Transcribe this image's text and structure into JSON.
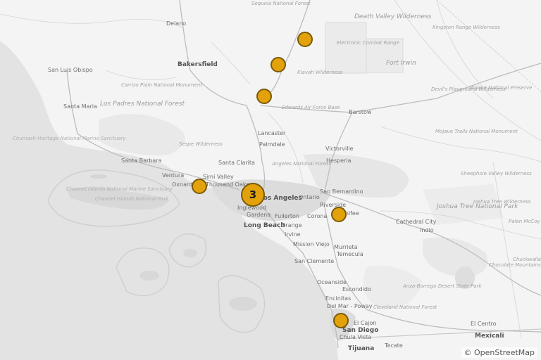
{
  "map": {
    "attribution": "© OpenStreetMap",
    "colors": {
      "land": "#f4f4f4",
      "ocean": "#e3e3e3",
      "marker_fill": "#e3a20c",
      "marker_stroke": "#7a5a08"
    },
    "places": [
      {
        "id": "sequoia-nf",
        "text": "Sequoia National Forest",
        "kind": "area"
      },
      {
        "id": "delano",
        "text": "Delano",
        "kind": "city"
      },
      {
        "id": "death-valley",
        "text": "Death Valley Wilderness",
        "kind": "area-large"
      },
      {
        "id": "kingston-range",
        "text": "Kingston Range Wilderness",
        "kind": "area"
      },
      {
        "id": "electronic-combat",
        "text": "Electronic Combat Range",
        "kind": "area"
      },
      {
        "id": "fort-irwin",
        "text": "Fort Irwin",
        "kind": "area-large"
      },
      {
        "id": "bakersfield",
        "text": "Bakersfield",
        "kind": "big"
      },
      {
        "id": "san-luis-obispo",
        "text": "San Luis Obispo",
        "kind": "city"
      },
      {
        "id": "carrizo-plain",
        "text": "Carrizo Plain National Monument",
        "kind": "area"
      },
      {
        "id": "kiavah",
        "text": "Kiavah Wilderness",
        "kind": "area"
      },
      {
        "id": "devils-playground",
        "text": "Devil's Playground Wilderness",
        "kind": "area"
      },
      {
        "id": "mojave-np",
        "text": "Mojave National Preserve",
        "kind": "area"
      },
      {
        "id": "santa-maria",
        "text": "Santa Maria",
        "kind": "city"
      },
      {
        "id": "los-padres",
        "text": "Los Padres National Forest",
        "kind": "area-large"
      },
      {
        "id": "edwards-afb",
        "text": "Edwards Air Force Base",
        "kind": "area"
      },
      {
        "id": "barstow",
        "text": "Barstow",
        "kind": "city"
      },
      {
        "id": "mojave-trails",
        "text": "Mojave Trails National Monument",
        "kind": "area"
      },
      {
        "id": "lancaster",
        "text": "Lancaster",
        "kind": "city"
      },
      {
        "id": "chumash",
        "text": "Chumash Heritage National Marine Sanctuary",
        "kind": "water"
      },
      {
        "id": "sespe",
        "text": "Sespe Wilderness",
        "kind": "area"
      },
      {
        "id": "palmdale",
        "text": "Palmdale",
        "kind": "city"
      },
      {
        "id": "victorville",
        "text": "Victorville",
        "kind": "city"
      },
      {
        "id": "santa-barbara",
        "text": "Santa Barbara",
        "kind": "city"
      },
      {
        "id": "santa-clarita",
        "text": "Santa Clarita",
        "kind": "city"
      },
      {
        "id": "angeles-nf",
        "text": "Angeles National Forest",
        "kind": "area"
      },
      {
        "id": "hesperia",
        "text": "Hesperia",
        "kind": "city"
      },
      {
        "id": "sheephole",
        "text": "Sheephole Valley Wilderness",
        "kind": "area"
      },
      {
        "id": "ventura",
        "text": "Ventura",
        "kind": "city"
      },
      {
        "id": "simi-valley",
        "text": "Simi Valley",
        "kind": "city"
      },
      {
        "id": "oxnard",
        "text": "Oxnard",
        "kind": "city"
      },
      {
        "id": "thousand-oaks",
        "text": "Thousand Oaks",
        "kind": "city"
      },
      {
        "id": "channel-islands",
        "text": "Channel Islands National Marine Sanctuary",
        "kind": "water"
      },
      {
        "id": "channel-np",
        "text": "Channel Islands National Park",
        "kind": "water"
      },
      {
        "id": "los-angeles",
        "text": "Los Angeles",
        "kind": "big"
      },
      {
        "id": "san-bernardino",
        "text": "San Bernardino",
        "kind": "city"
      },
      {
        "id": "ontario",
        "text": "Ontario",
        "kind": "city"
      },
      {
        "id": "joshua-tree-np",
        "text": "Joshua Tree National Park",
        "kind": "area-large"
      },
      {
        "id": "joshua-tree-wild",
        "text": "Joshua Tree Wilderness",
        "kind": "area"
      },
      {
        "id": "inglewood",
        "text": "Inglewood",
        "kind": "city"
      },
      {
        "id": "riverside",
        "text": "Riverside",
        "kind": "city"
      },
      {
        "id": "fullerton",
        "text": "Fullerton",
        "kind": "city"
      },
      {
        "id": "corona",
        "text": "Corona",
        "kind": "city"
      },
      {
        "id": "gardena",
        "text": "Gardena",
        "kind": "city"
      },
      {
        "id": "long-beach",
        "text": "Long Beach",
        "kind": "big"
      },
      {
        "id": "orange",
        "text": "Orange",
        "kind": "city"
      },
      {
        "id": "menifee",
        "text": "Menifee",
        "kind": "city"
      },
      {
        "id": "cathedral-city",
        "text": "Cathedral City",
        "kind": "city"
      },
      {
        "id": "indio",
        "text": "Indio",
        "kind": "city"
      },
      {
        "id": "palen-mccoy",
        "text": "Palen McCoy Wilderness",
        "kind": "area"
      },
      {
        "id": "irvine",
        "text": "Irvine",
        "kind": "city"
      },
      {
        "id": "mission-viejo",
        "text": "Mission Viejo",
        "kind": "city"
      },
      {
        "id": "murrieta",
        "text": "Murrieta",
        "kind": "city"
      },
      {
        "id": "temecula",
        "text": "Temecula",
        "kind": "city"
      },
      {
        "id": "san-clemente",
        "text": "San Clemente",
        "kind": "city"
      },
      {
        "id": "chuckwalla",
        "text": "Chuckwalla National Monument",
        "kind": "area"
      },
      {
        "id": "chocolate-mts",
        "text": "Chocolate Mountains Gunnery Range",
        "kind": "area"
      },
      {
        "id": "anza-borrego",
        "text": "Anza-Borrego Desert State Park",
        "kind": "area"
      },
      {
        "id": "oceanside",
        "text": "Oceanside",
        "kind": "city"
      },
      {
        "id": "escondido",
        "text": "Escondido",
        "kind": "city"
      },
      {
        "id": "encinitas",
        "text": "Encinitas",
        "kind": "city"
      },
      {
        "id": "poway",
        "text": "Del Mar - Poway",
        "kind": "city"
      },
      {
        "id": "cleveland-nf",
        "text": "Cleveland National Forest",
        "kind": "area"
      },
      {
        "id": "el-centro",
        "text": "El Centro",
        "kind": "city"
      },
      {
        "id": "el-cajon",
        "text": "El Cajon",
        "kind": "city"
      },
      {
        "id": "san-diego",
        "text": "San Diego",
        "kind": "big"
      },
      {
        "id": "chula-vista",
        "text": "Chula Vista",
        "kind": "city"
      },
      {
        "id": "mexicali",
        "text": "Mexicali",
        "kind": "big"
      },
      {
        "id": "tijuana",
        "text": "Tijuana",
        "kind": "big"
      },
      {
        "id": "tecate",
        "text": "Tecate",
        "kind": "city"
      }
    ],
    "markers": [
      {
        "id": "m1",
        "type": "single",
        "label": ""
      },
      {
        "id": "m2",
        "type": "single",
        "label": ""
      },
      {
        "id": "m3",
        "type": "single",
        "label": ""
      },
      {
        "id": "m4",
        "type": "single",
        "label": ""
      },
      {
        "id": "m5",
        "type": "cluster",
        "label": "3"
      },
      {
        "id": "m6",
        "type": "single",
        "label": ""
      },
      {
        "id": "m7",
        "type": "single",
        "label": ""
      }
    ]
  }
}
